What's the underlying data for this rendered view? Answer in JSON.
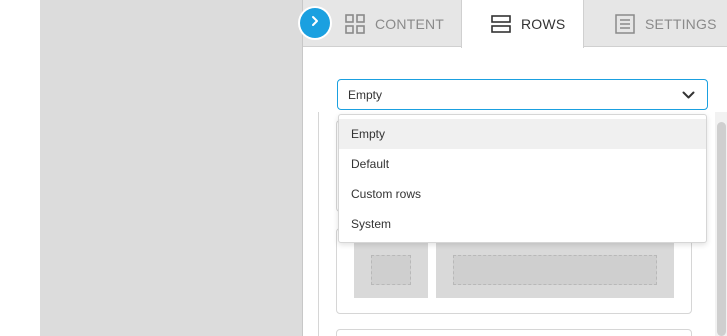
{
  "tabs": [
    {
      "label": "CONTENT",
      "icon": "grid-icon",
      "active": false
    },
    {
      "label": "ROWS",
      "icon": "rows-icon",
      "active": true
    },
    {
      "label": "SETTINGS",
      "icon": "settings-list-icon",
      "active": false
    }
  ],
  "toggle": {
    "icon": "chevron-right-icon",
    "color": "#1aa0e0"
  },
  "select": {
    "value": "Empty",
    "icon": "chevron-down-icon",
    "accent": "#1aa0e0"
  },
  "dropdown": {
    "options": [
      "Empty",
      "Default",
      "Custom rows",
      "System"
    ],
    "highlighted": "Empty"
  },
  "colors": {
    "accent": "#1aa0e0",
    "canvas": "#dcdcdc",
    "tabbar": "#e6e6e6"
  }
}
